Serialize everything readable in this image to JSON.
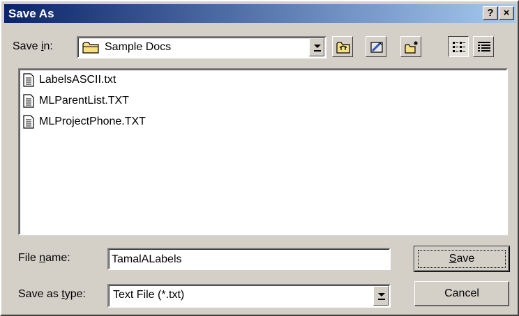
{
  "window": {
    "title": "Save As",
    "help_button": "?",
    "close_button": "×"
  },
  "save_in": {
    "label_pre": "Save ",
    "label_accel": "i",
    "label_post": "n:",
    "value": "Sample Docs",
    "icon": "folder-icon"
  },
  "toolbar": {
    "buttons": [
      {
        "name": "up-one-level",
        "icon": "up-folder-icon"
      },
      {
        "name": "desktop",
        "icon": "desktop-icon"
      },
      {
        "name": "create-new-folder",
        "icon": "new-folder-icon"
      },
      {
        "name": "list-view",
        "icon": "list-view-icon",
        "pressed": true
      },
      {
        "name": "details-view",
        "icon": "details-view-icon"
      }
    ]
  },
  "files": [
    {
      "name": "LabelsASCII.txt",
      "icon": "text-file-icon"
    },
    {
      "name": "MLParentList.TXT",
      "icon": "text-file-icon"
    },
    {
      "name": "MLProjectPhone.TXT",
      "icon": "text-file-icon"
    }
  ],
  "file_name": {
    "label_pre": "File ",
    "label_accel": "n",
    "label_post": "ame:",
    "value": "TamalALabels"
  },
  "save_as_type": {
    "label_pre": "Save as ",
    "label_accel": "t",
    "label_post": "ype:",
    "value": "Text File (*.txt)"
  },
  "buttons": {
    "save_accel": "S",
    "save_rest": "ave",
    "cancel": "Cancel"
  },
  "colors": {
    "title_start": "#0a246a",
    "title_end": "#a6caf0",
    "face": "#d4d0c8",
    "folder_yellow": "#f8e080"
  }
}
